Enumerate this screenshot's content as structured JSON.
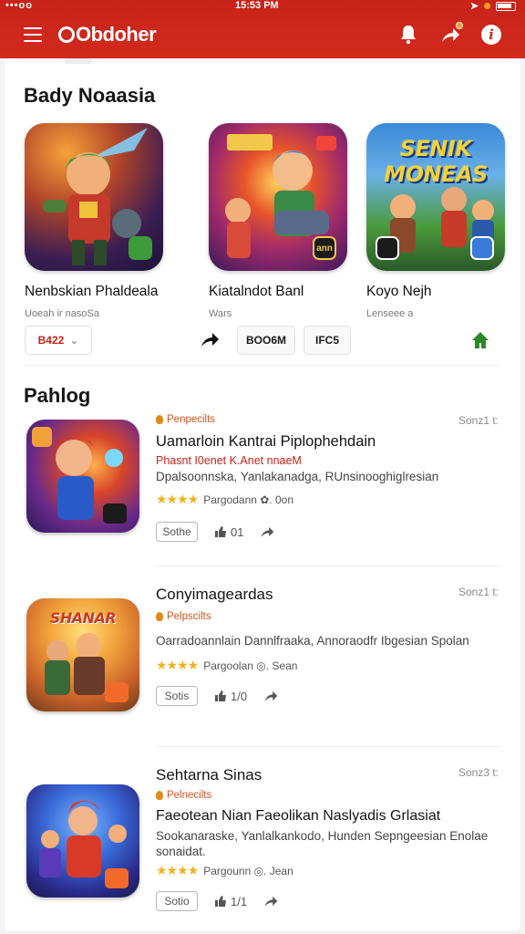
{
  "status": {
    "carrier": "•••oo",
    "time": "15:53 PM"
  },
  "appbar": {
    "logo_text": "Obdoher",
    "icons": [
      "menu-icon",
      "bell-icon",
      "share-icon",
      "info-icon"
    ]
  },
  "featured": {
    "title": "Bady Noaasia",
    "tiles": [
      {
        "name": "Nenbskian Phaldeala",
        "sub": "Uoeah ir nasoSa",
        "badge": "",
        "badge_color": "#3d9a3a"
      },
      {
        "name": "Kiatalndot Banl",
        "sub": "Wars",
        "badge": "ann",
        "badge_color": "#1b1b1b"
      },
      {
        "name": "Koyo Nejh",
        "sub": "Lenseee a",
        "badge": "",
        "badge_color": "#1b1b1b",
        "art_title": "SENIK MONEAS"
      }
    ],
    "chips": {
      "filter": "B422",
      "btn1": "BOO6M",
      "btn2": "IFC5"
    }
  },
  "list": {
    "title": "Pahlog",
    "items": [
      {
        "category": "Penpecilts",
        "time": "Sonz1 t:",
        "title": "Uamarloin Kantrai Piplophehdain",
        "red": "Phasnt I0enet  K.Anet  nnaeM",
        "desc": "Dpalsoonnska, Yanlakanadga, RUnsinooghiglresian",
        "rating": "Pargodann  ✿. 0on",
        "score": "Sothe",
        "likes": "01",
        "stars": "★★★★"
      },
      {
        "category": "Pelpscilts",
        "time": "Sonz1 t:",
        "title": "Conyimageardas",
        "red": "",
        "desc": "Oarradoannlain Dannlfraaka, Annoraodfr Ibgesian Spolan",
        "rating": "Pargoolan  ◎. Sean",
        "score": "Sotis",
        "likes": "1/0",
        "stars": "★★★★"
      },
      {
        "category": "Pelnecilts",
        "time": "Sonz3 t:",
        "title": "Sehtarna Sinas",
        "title2": "Faeotean Nian Faeolikan Naslyadis Grlasiat",
        "desc": "Sookanaraske, Yanlalkankodo, Hunden Sepngeesian Enolae sonaidat.",
        "rating": "Pargounn  ◎. Jean",
        "score": "Sotio",
        "likes": "1/1",
        "stars": "★★★★"
      }
    ]
  }
}
